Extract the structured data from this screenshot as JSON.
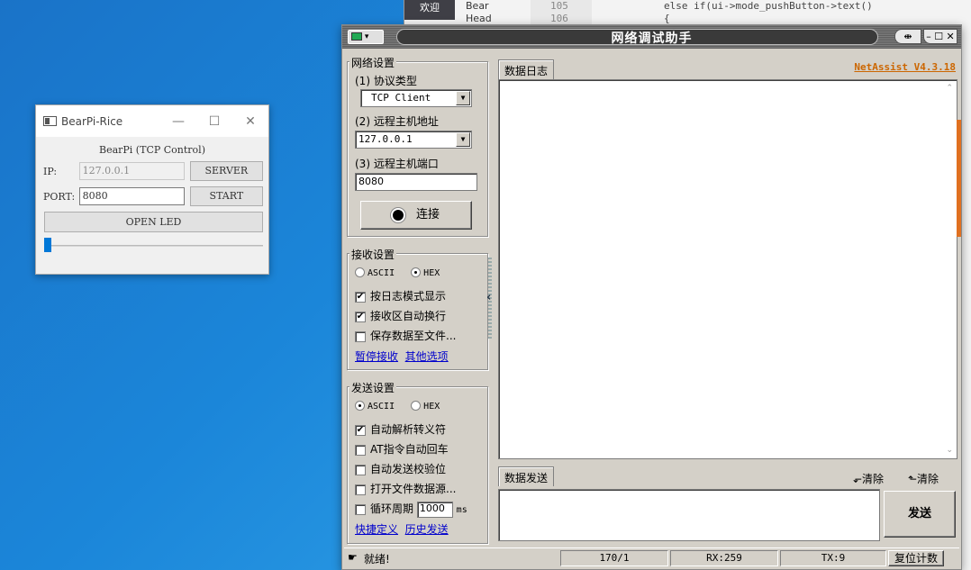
{
  "ide": {
    "tab_label": "欢迎",
    "tree_items": [
      "Bear",
      "Head"
    ],
    "line_numbers": [
      "105",
      "106"
    ],
    "code_lines": [
      "else if(ui->mode_pushButton->text()",
      "{"
    ]
  },
  "bearpi": {
    "window_title": "BearPi-Rice",
    "caption": "BearPi (TCP Control)",
    "ip_label": "IP:",
    "ip_value": "127.0.0.1",
    "server_label": "SERVER",
    "port_label": "PORT:",
    "port_value": "8080",
    "start_label": "START",
    "open_led_label": "OPEN LED",
    "slider_value": 0,
    "window_controls": [
      "—",
      "☐",
      "✕"
    ]
  },
  "netassist": {
    "window_title": "网络调试助手",
    "version_link": "NetAssist V4.3.18",
    "net_settings": {
      "title": "网络设置",
      "protocol_label": "(1) 协议类型",
      "protocol_value": "TCP Client",
      "host_label": "(2) 远程主机地址",
      "host_value": "127.0.0.1",
      "port_label": "(3) 远程主机端口",
      "port_value": "8080",
      "connect_label": "连接"
    },
    "recv_settings": {
      "title": "接收设置",
      "ascii": "ASCII",
      "hex": "HEX",
      "selected": "HEX",
      "options": [
        {
          "label": "按日志模式显示",
          "checked": true
        },
        {
          "label": "接收区自动换行",
          "checked": true
        },
        {
          "label": "保存数据至文件...",
          "checked": false
        }
      ],
      "links": [
        "暂停接收",
        "其他选项"
      ]
    },
    "send_settings": {
      "title": "发送设置",
      "ascii": "ASCII",
      "hex": "HEX",
      "selected": "ASCII",
      "options": [
        {
          "label": "自动解析转义符",
          "checked": true
        },
        {
          "label": "AT指令自动回车",
          "checked": false
        },
        {
          "label": "自动发送校验位",
          "checked": false
        },
        {
          "label": "打开文件数据源...",
          "checked": false
        }
      ],
      "loop_label": "循环周期",
      "loop_value": "1000",
      "loop_unit": "ms",
      "links": [
        "快捷定义",
        "历史发送"
      ]
    },
    "log_tab": "数据日志",
    "send_tab": "数据发送",
    "clear_label_1": "清除",
    "clear_label_2": "清除",
    "send_button": "发送",
    "status": {
      "ready": "就绪!",
      "counter": "170/1",
      "rx": "RX:259",
      "tx": "TX:9",
      "reset": "复位计数"
    },
    "colors": {
      "version_link": "#cc6600",
      "link": "#0000cc"
    }
  }
}
